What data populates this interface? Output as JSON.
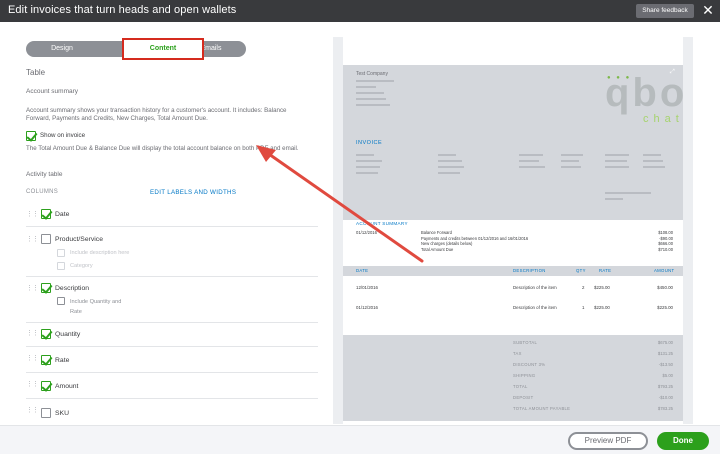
{
  "window": {
    "title": "Edit invoices that turn heads and open wallets",
    "feedback_label": "Share feedback",
    "close_glyph": "✕"
  },
  "tabs": [
    {
      "label": "Design"
    },
    {
      "label": "Content"
    },
    {
      "label": "Emails"
    }
  ],
  "left": {
    "section_title": "Table",
    "summary_title": "Account summary",
    "summary_desc": "Account summary shows your transaction history for a customer's account. It includes: Balance Forward, Payments and Credits, New Charges, Total Amount Due.",
    "show_on_invoice": {
      "label": "Show on invoice",
      "checked": true
    },
    "balance_note": "The Total Amount Due & Balance Due will display the total account balance on both PDF and email.",
    "activity_title": "Activity table",
    "columns_label": "COLUMNS",
    "edit_link": "EDIT LABELS AND WIDTHS",
    "columns": [
      {
        "name": "Date",
        "checked": true
      },
      {
        "name": "Product/Service",
        "checked": false,
        "sub_options": [
          "Include description here",
          "Category"
        ]
      },
      {
        "name": "Description",
        "checked": true,
        "sub_options": [
          "Include Quantity and Rate"
        ]
      },
      {
        "name": "Quantity",
        "checked": true
      },
      {
        "name": "Rate",
        "checked": true
      },
      {
        "name": "Amount",
        "checked": true
      },
      {
        "name": "SKU",
        "checked": false
      }
    ]
  },
  "preview": {
    "company_name": "Test Company",
    "invoice_label": "INVOICE",
    "logo_text": "qbo",
    "logo_sub": "chat",
    "account_summary_label": "ACCOUNT SUMMARY",
    "summary_date": "01/12/2016",
    "summary_lines": [
      "Balance Forward",
      "Payments and credits between 01/12/2016 and 16/01/2016",
      "New charges (details below)",
      "Total Amount Due"
    ],
    "summary_amounts": [
      "$108.00",
      "-$90.00",
      "$666.00",
      "$710.00"
    ],
    "columns": [
      "DATE",
      "DESCRIPTION",
      "QTY",
      "RATE",
      "AMOUNT"
    ],
    "items": [
      {
        "date": "12/01/2016",
        "description": "Description of the item",
        "qty": "2",
        "rate": "$225.00",
        "amount": "$450.00"
      },
      {
        "date": "01/12/2016",
        "description": "Description of the item",
        "qty": "1",
        "rate": "$225.00",
        "amount": "$225.00"
      }
    ],
    "totals": [
      {
        "label": "SUBTOTAL",
        "value": "$675.00"
      },
      {
        "label": "TAX",
        "value": "$131.25"
      },
      {
        "label": "DISCOUNT 3%",
        "value": "-$13.50"
      },
      {
        "label": "SHIPPING",
        "value": "$5.00"
      },
      {
        "label": "TOTAL",
        "value": "$793.25"
      },
      {
        "label": "DEPOSIT",
        "value": "-$10.00"
      },
      {
        "label": "TOTAL AMOUNT PAYABLE",
        "value": "$783.25"
      }
    ]
  },
  "footer": {
    "preview_label": "Preview PDF",
    "done_label": "Done"
  },
  "colors": {
    "accent_green": "#2ca01c",
    "highlight_red": "#d52b1e",
    "arrow_red": "#e04a3f",
    "link_blue": "#0077c5"
  }
}
